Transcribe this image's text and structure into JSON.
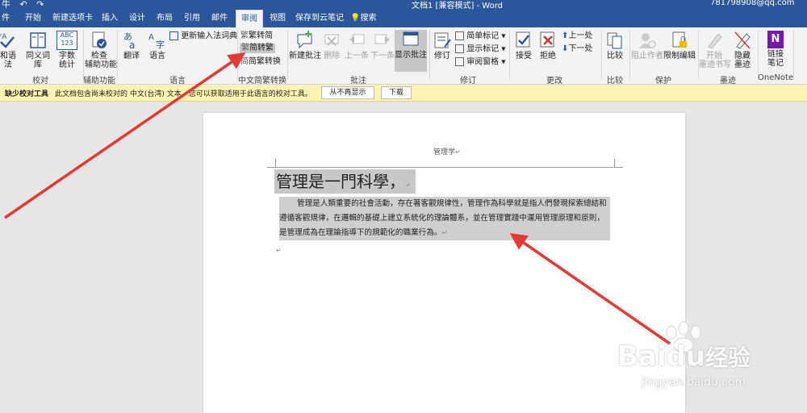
{
  "titlebar": {
    "qat_glyphs": "牛 ↶ ↷",
    "doc_title": "文档1 [兼容模式] - Word",
    "account": "781798908@qq.com"
  },
  "tabs": [
    {
      "label": "件"
    },
    {
      "label": "开始"
    },
    {
      "label": "新建选项卡"
    },
    {
      "label": "插入"
    },
    {
      "label": "设计"
    },
    {
      "label": "布局"
    },
    {
      "label": "引用"
    },
    {
      "label": "邮件"
    },
    {
      "label": "审阅"
    },
    {
      "label": "视图"
    },
    {
      "label": "保存到云笔记"
    },
    {
      "label": "搜索"
    }
  ],
  "ribbon": {
    "proofing": {
      "spelling_label": "和语法",
      "thesaurus_label": "同义词库",
      "wordcount_label": "字数\n统计",
      "wordcount_icon_text": "ABC\n123",
      "group_label": "校对"
    },
    "accessibility": {
      "check_label": "检查\n辅助功能",
      "group_label": "辅助功能"
    },
    "language": {
      "translate_label": "翻译",
      "language_label": "语言",
      "update_ime_label": "更新输入法词典",
      "group_label": "语言"
    },
    "chinese_conversion": {
      "trad_to_simp": "繁转简",
      "simp_to_trad": "简转繁",
      "conversion": "简繁转换",
      "group_label": "中文简繁转换"
    },
    "comments": {
      "new_label": "新建批注",
      "delete_label": "删除",
      "prev_label": "上一条",
      "next_label": "下一条",
      "show_label": "显示批注",
      "group_label": "批注"
    },
    "tracking": {
      "track_label": "修订",
      "simple_markup": "简单标记",
      "show_markup": "显示标记",
      "review_pane": "审阅窗格",
      "group_label": "修订"
    },
    "changes": {
      "accept_label": "接受",
      "reject_label": "拒绝",
      "prev_label": "上一处",
      "next_label": "下一处",
      "group_label": "更改"
    },
    "compare": {
      "compare_label": "比较",
      "group_label": "比较"
    },
    "protect": {
      "block_authors_label": "阻止作者",
      "restrict_label": "限制编辑",
      "group_label": "保护"
    },
    "ink": {
      "start_ink_label": "开始\n墨迹书写",
      "hide_ink_label": "隐藏\n墨迹",
      "group_label": "墨迹"
    },
    "onenote": {
      "linked_notes_label": "链接\n笔记",
      "icon_letter": "N",
      "group_label": "OneNote"
    }
  },
  "infobar": {
    "title": "缺少校对工具",
    "message": "此文档包含尚未校对的 中文(台湾) 文本。您可以获取适用于此语言的校对工具。",
    "dont_show_label": "从不再显示",
    "download_label": "下载"
  },
  "document": {
    "header_text": "管理学",
    "heading": "管理是一門科學，",
    "body_text": "管理是人類重要的社會活動，存在著客觀規律性，管理作為科學就是指人們發現探索總結和遵循客觀規律，在邏輯的基礎上建立系統化的理論體系，並在管理實踐中運用管理原理和原則，是管理成為在理論指導下的規範化的職業行為。",
    "paragraph_mark": "↵"
  },
  "watermark": {
    "brand": "Baidu",
    "brand_cn": "经验",
    "url": "jingyan.baidu.com"
  },
  "colors": {
    "ribbon_blue": "#2b579a",
    "arrow_red": "#e53935",
    "selection_gray": "#c8c8c8",
    "infobar_yellow": "#fdf3b2"
  }
}
